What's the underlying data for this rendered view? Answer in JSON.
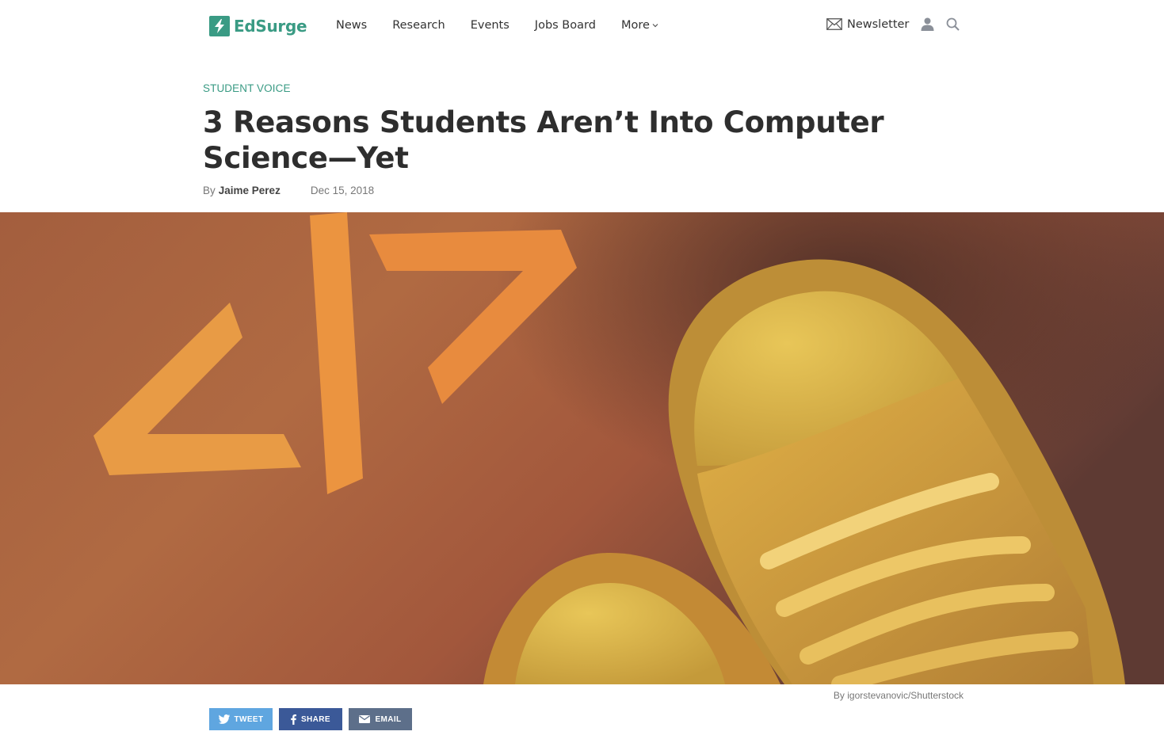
{
  "brand": {
    "name": "EdSurge",
    "color": "#3a9b84",
    "icon": "lightning-bolt-icon"
  },
  "nav": {
    "items": [
      {
        "label": "News"
      },
      {
        "label": "Research"
      },
      {
        "label": "Events"
      },
      {
        "label": "Jobs Board"
      },
      {
        "label": "More"
      }
    ]
  },
  "header_actions": {
    "newsletter_label": "Newsletter",
    "newsletter_icon": "envelope-icon",
    "account_icon": "user-icon",
    "search_icon": "search-icon"
  },
  "article": {
    "kicker": "STUDENT VOICE",
    "title": "3 Reasons Students Aren’t Into Computer Science—Yet",
    "byline_prefix": "By",
    "author": "Jaime Perez",
    "date": "Dec 15, 2018",
    "hero_alt": "Code symbol </> on cardboard next to yellow sneakers",
    "photo_credit": "By igorstevanovic/Shutterstock"
  },
  "share": {
    "tweet_label": "TWEET",
    "share_label": "SHARE",
    "email_label": "EMAIL",
    "colors": {
      "twitter": "#5fa6e0",
      "facebook": "#3b5998",
      "email": "#5d6f8a"
    }
  }
}
